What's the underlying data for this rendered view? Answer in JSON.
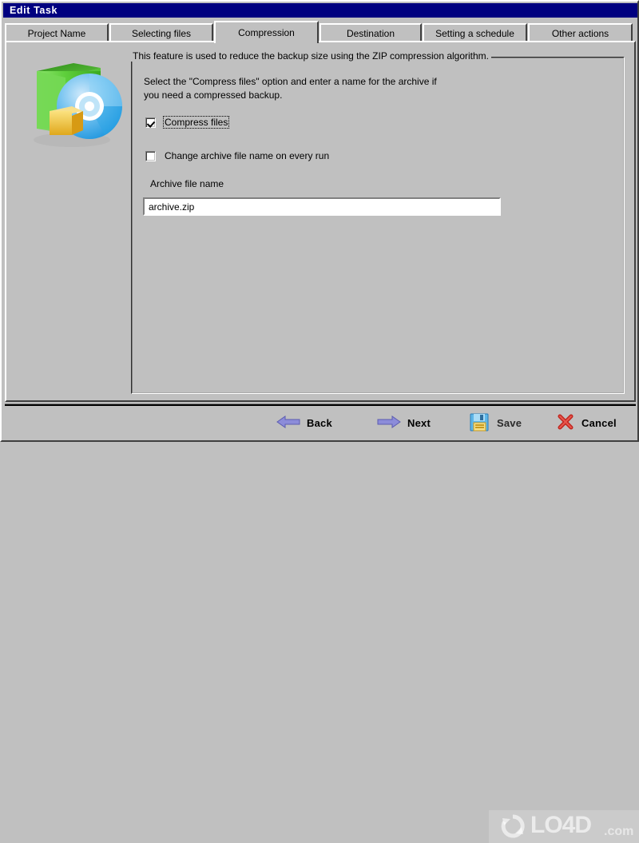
{
  "window": {
    "title": "Edit Task"
  },
  "tabs": [
    {
      "label": "Project Name",
      "active": false
    },
    {
      "label": "Selecting files",
      "active": false
    },
    {
      "label": "Compression",
      "active": true
    },
    {
      "label": "Destination",
      "active": false
    },
    {
      "label": "Setting a schedule",
      "active": false
    },
    {
      "label": "Other actions",
      "active": false
    }
  ],
  "illustration": {
    "icon_name": "backup-package-disc-icon",
    "colors": {
      "box": "#4dc42a",
      "disc": "#3aa7e8",
      "cube": "#f2cc3a"
    }
  },
  "group": {
    "legend": "This feature is used to reduce the backup size using the ZIP compression algorithm.",
    "description_line1": "Select the \"Compress files\" option and enter a name for the archive if",
    "description_line2": "you need a compressed backup."
  },
  "options": {
    "compress_files": {
      "label": "Compress files",
      "checked": true,
      "focused": true
    },
    "change_name_every_run": {
      "label": "Change archive file name on every run",
      "checked": false,
      "focused": false
    }
  },
  "archive_field": {
    "label": "Archive file name",
    "value": "archive.zip",
    "placeholder": "archive.zip"
  },
  "buttons": {
    "back": {
      "label": "Back",
      "icon_name": "arrow-left-icon"
    },
    "next": {
      "label": "Next",
      "icon_name": "arrow-right-icon"
    },
    "save": {
      "label": "Save",
      "icon_name": "floppy-disk-icon"
    },
    "cancel": {
      "label": "Cancel",
      "icon_name": "red-x-icon"
    }
  },
  "watermark": {
    "text": "LO4D",
    "suffix": ".com",
    "icon_name": "circular-arrows-icon"
  },
  "colors": {
    "titlebar": "#000080",
    "face": "#c0c0c0",
    "arrow": "#8c8cd9",
    "accent_green": "#4dc42a"
  }
}
